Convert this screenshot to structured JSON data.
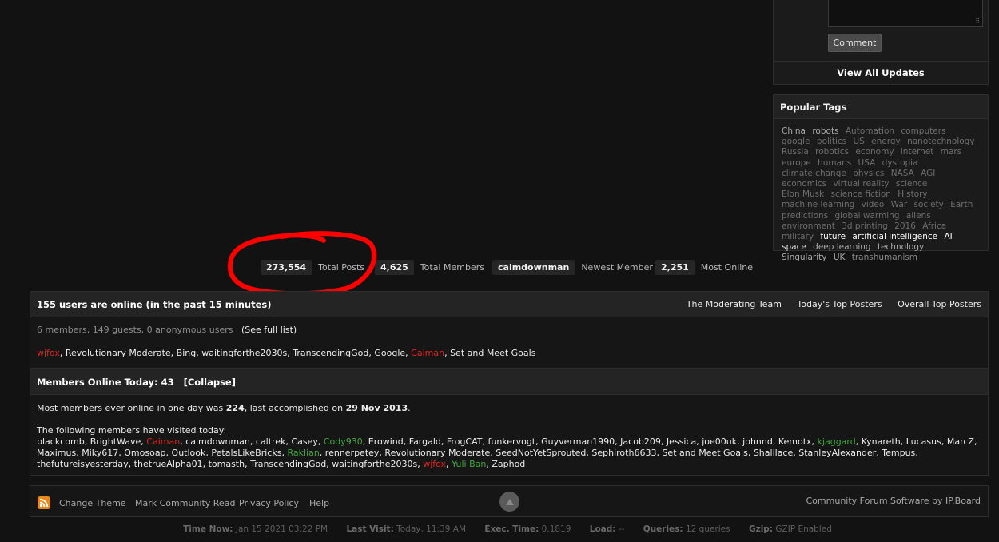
{
  "sidebar": {
    "comment_button": "Comment",
    "view_all_updates": "View All Updates",
    "popular_tags_title": "Popular Tags",
    "tags": [
      {
        "t": "China",
        "w": 3
      },
      {
        "t": "robots",
        "w": 3
      },
      {
        "t": "Automation",
        "w": 1
      },
      {
        "t": "computers",
        "w": 1
      },
      {
        "t": "google",
        "w": 1
      },
      {
        "t": "politics",
        "w": 1
      },
      {
        "t": "US",
        "w": 1
      },
      {
        "t": "energy",
        "w": 1
      },
      {
        "t": "nanotechnology",
        "w": 1
      },
      {
        "t": "Russia",
        "w": 1
      },
      {
        "t": "robotics",
        "w": 1
      },
      {
        "t": "economy",
        "w": 1
      },
      {
        "t": "internet",
        "w": 1
      },
      {
        "t": "mars",
        "w": 1
      },
      {
        "t": "europe",
        "w": 1
      },
      {
        "t": "humans",
        "w": 1
      },
      {
        "t": "USA",
        "w": 1
      },
      {
        "t": "dystopia",
        "w": 1
      },
      {
        "t": "climate change",
        "w": 1
      },
      {
        "t": "physics",
        "w": 1
      },
      {
        "t": "NASA",
        "w": 1
      },
      {
        "t": "AGI",
        "w": 1
      },
      {
        "t": "economics",
        "w": 1
      },
      {
        "t": "virtual reality",
        "w": 1
      },
      {
        "t": "science",
        "w": 1
      },
      {
        "t": "Elon Musk",
        "w": 1
      },
      {
        "t": "science fiction",
        "w": 1
      },
      {
        "t": "History",
        "w": 1
      },
      {
        "t": "machine learning",
        "w": 1
      },
      {
        "t": "video",
        "w": 1
      },
      {
        "t": "War",
        "w": 1
      },
      {
        "t": "society",
        "w": 1
      },
      {
        "t": "Earth",
        "w": 1
      },
      {
        "t": "predictions",
        "w": 1
      },
      {
        "t": "global warming",
        "w": 1
      },
      {
        "t": "aliens",
        "w": 1
      },
      {
        "t": "environment",
        "w": 1
      },
      {
        "t": "3d printing",
        "w": 1
      },
      {
        "t": "2016",
        "w": 1
      },
      {
        "t": "Africa",
        "w": 1
      },
      {
        "t": "military",
        "w": 1
      },
      {
        "t": "future",
        "w": 5
      },
      {
        "t": "artificial intelligence",
        "w": 5
      },
      {
        "t": "AI",
        "w": 5
      },
      {
        "t": "space",
        "w": 4
      },
      {
        "t": "deep learning",
        "w": 3
      },
      {
        "t": "technology",
        "w": 3
      },
      {
        "t": "Singularity",
        "w": 3
      },
      {
        "t": "UK",
        "w": 3
      },
      {
        "t": "transhumanism",
        "w": 2
      }
    ]
  },
  "stats": {
    "total_posts": {
      "value": "273,554",
      "label": "Total Posts"
    },
    "total_members": {
      "value": "4,625",
      "label": "Total Members"
    },
    "newest_member": {
      "value": "calmdownman",
      "label": "Newest Member"
    },
    "most_online": {
      "value": "2,251",
      "label": "Most Online"
    }
  },
  "online": {
    "title": "155 users are online (in the past 15 minutes)",
    "links": [
      "The Moderating Team",
      "Today's Top Posters",
      "Overall Top Posters"
    ],
    "counts": "6 members, 149 guests, 0 anonymous users",
    "full_list": "(See full list)",
    "members": [
      {
        "n": "wjfox",
        "c": "red"
      },
      {
        "n": "Revolutionary Moderate",
        "c": "white"
      },
      {
        "n": "Bing",
        "c": "white"
      },
      {
        "n": "waitingforthe2030s",
        "c": "white"
      },
      {
        "n": "TranscendingGod",
        "c": "white"
      },
      {
        "n": "Google",
        "c": "white"
      },
      {
        "n": "Caiman",
        "c": "red"
      },
      {
        "n": "Set and Meet Goals",
        "c": "white"
      }
    ]
  },
  "today": {
    "title": "Members Online Today: 43",
    "collapse": "[Collapse]",
    "record_prefix": "Most members ever online in one day was ",
    "record_count": "224",
    "record_mid": ", last accomplished on ",
    "record_date": "29 Nov 2013",
    "record_suffix": ".",
    "intro": "The following members have visited today:",
    "members": [
      {
        "n": "blackcomb",
        "c": "white"
      },
      {
        "n": "BrightWave",
        "c": "white"
      },
      {
        "n": "Caiman",
        "c": "red"
      },
      {
        "n": "calmdownman",
        "c": "white"
      },
      {
        "n": "caltrek",
        "c": "white"
      },
      {
        "n": "Casey",
        "c": "white"
      },
      {
        "n": "Cody930",
        "c": "green"
      },
      {
        "n": "Erowind",
        "c": "white"
      },
      {
        "n": "Fargald",
        "c": "white"
      },
      {
        "n": "FrogCAT",
        "c": "white"
      },
      {
        "n": "funkervogt",
        "c": "white"
      },
      {
        "n": "Guyverman1990",
        "c": "white"
      },
      {
        "n": "Jacob209",
        "c": "white"
      },
      {
        "n": "Jessica",
        "c": "white"
      },
      {
        "n": "joe00uk",
        "c": "white"
      },
      {
        "n": "johnnd",
        "c": "white"
      },
      {
        "n": "Kemotx",
        "c": "white"
      },
      {
        "n": "kjaggard",
        "c": "green"
      },
      {
        "n": "Kynareth",
        "c": "white"
      },
      {
        "n": "Lucasus",
        "c": "white"
      },
      {
        "n": "MarcZ",
        "c": "white"
      },
      {
        "n": "Maximus",
        "c": "white"
      },
      {
        "n": "Miky617",
        "c": "white"
      },
      {
        "n": "Omosoap",
        "c": "white"
      },
      {
        "n": "Outlook",
        "c": "white"
      },
      {
        "n": "PetalsLikeBricks",
        "c": "white"
      },
      {
        "n": "Raklian",
        "c": "green"
      },
      {
        "n": "rennerpetey",
        "c": "white"
      },
      {
        "n": "Revolutionary Moderate",
        "c": "white"
      },
      {
        "n": "SeedNotYetSprouted",
        "c": "white"
      },
      {
        "n": "Sephiroth6633",
        "c": "white"
      },
      {
        "n": "Set and Meet Goals",
        "c": "white"
      },
      {
        "n": "Shalilace",
        "c": "white"
      },
      {
        "n": "StanleyAlexander",
        "c": "white"
      },
      {
        "n": "Tempus",
        "c": "white"
      },
      {
        "n": "thefutureisyesterday",
        "c": "white"
      },
      {
        "n": "thetrueAlpha01",
        "c": "white"
      },
      {
        "n": "tomasth",
        "c": "white"
      },
      {
        "n": "TranscendingGod",
        "c": "white"
      },
      {
        "n": "waitingforthe2030s",
        "c": "white"
      },
      {
        "n": "wjfox",
        "c": "red"
      },
      {
        "n": "Yuli Ban",
        "c": "green"
      },
      {
        "n": "Zaphod",
        "c": "white"
      }
    ]
  },
  "footer": {
    "links": [
      "Change Theme",
      "Mark Community Read",
      "Privacy Policy",
      "Help"
    ],
    "powered_by": "Community Forum Software by IP.Board"
  },
  "stats_bar": [
    {
      "k": "Time Now:",
      "v": "Jan 15 2021 03:22 PM"
    },
    {
      "k": "Last Visit:",
      "v": "Today, 11:39 AM"
    },
    {
      "k": "Exec. Time:",
      "v": "0.1819"
    },
    {
      "k": "Load:",
      "v": "--"
    },
    {
      "k": "Queries:",
      "v": "12 queries"
    },
    {
      "k": "Gzip:",
      "v": "GZIP Enabled"
    }
  ],
  "colors": {
    "accent_red": "#e02424",
    "accent_green": "#3fa83f",
    "annotation_red": "#ff0000"
  }
}
